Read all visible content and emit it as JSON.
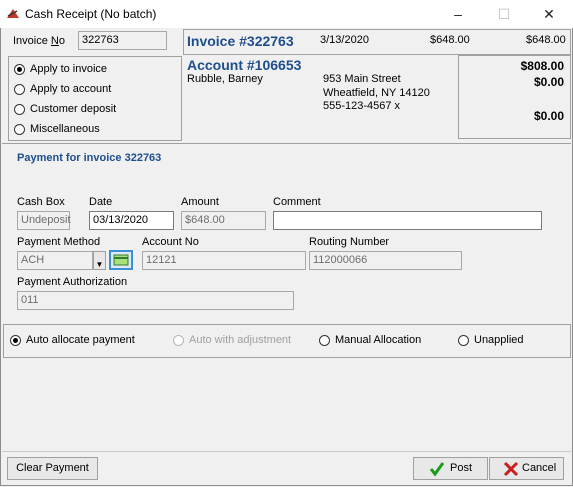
{
  "window": {
    "title": "Cash Receipt (No batch)"
  },
  "invoice_no": {
    "label": "Invoice No",
    "value": "322763"
  },
  "apply_options": [
    {
      "label": "Apply to invoice",
      "selected": true
    },
    {
      "label": "Apply to account",
      "selected": false
    },
    {
      "label": "Customer deposit",
      "selected": false
    },
    {
      "label": "Miscellaneous",
      "selected": false
    }
  ],
  "invoice_header": {
    "title": "Invoice #322763",
    "date": "3/13/2020",
    "amount1": "$648.00",
    "amount2": "$648.00"
  },
  "account": {
    "title": "Account #106653",
    "name": "Rubble, Barney",
    "address_line1": "953 Main Street",
    "address_line2": "Wheatfield, NY  14120",
    "phone": "555-123-4567 x"
  },
  "balances": {
    "b1": "$808.00",
    "b2": "$0.00",
    "b3": "$0.00"
  },
  "payment_title": "Payment for invoice 322763",
  "form": {
    "cash_box": {
      "label": "Cash Box",
      "value": "Undeposit"
    },
    "date": {
      "label": "Date",
      "value": "03/13/2020"
    },
    "amount": {
      "label": "Amount",
      "value": "$648.00"
    },
    "comment": {
      "label": "Comment",
      "value": ""
    },
    "payment_method": {
      "label": "Payment Method",
      "value": "ACH"
    },
    "account_no": {
      "label": "Account No",
      "value": "12121"
    },
    "routing_number": {
      "label": "Routing Number",
      "value": "112000066"
    },
    "payment_authorization": {
      "label": "Payment Authorization",
      "value": "011"
    }
  },
  "allocation_options": [
    {
      "label": "Auto allocate payment",
      "selected": true,
      "enabled": true
    },
    {
      "label": "Auto with adjustment",
      "selected": false,
      "enabled": false
    },
    {
      "label": "Manual Allocation",
      "selected": false,
      "enabled": true
    },
    {
      "label": "Unapplied",
      "selected": false,
      "enabled": true
    }
  ],
  "buttons": {
    "clear_payment": "Clear Payment",
    "post": "Post",
    "cancel": "Cancel"
  },
  "colors": {
    "accent_blue": "#1e4e8c",
    "check_green": "#1a9b1a",
    "cancel_red": "#c81e1e"
  }
}
